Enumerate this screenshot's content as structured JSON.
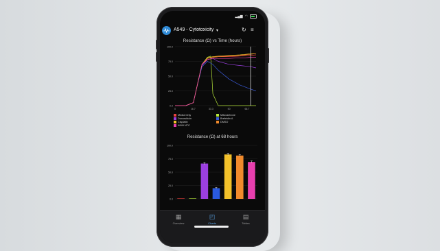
{
  "status_bar": {
    "signal": "▂▄▆",
    "wifi": "◠"
  },
  "header": {
    "title": "A549 - Cytotoxicity",
    "chevron": "▾",
    "refresh_icon": "↻",
    "menu_icon": "≡"
  },
  "line_chart": {
    "title": "Resistance (Ω) vs Time (hours)",
    "y_ticks": [
      "100.0",
      "75.0",
      "50.0",
      "25.0",
      "0.0"
    ],
    "x_ticks": [
      "0",
      "16.7",
      "33.3",
      "50",
      "66.7"
    ],
    "legend": [
      {
        "label": "Media Only",
        "color": "#e8423f"
      },
      {
        "label": "Mitoxantrone",
        "color": "#b6e63a"
      },
      {
        "label": "Doxorubicin",
        "color": "#9b3fe0"
      },
      {
        "label": "Brefeldin A",
        "color": "#3a5ad8"
      },
      {
        "label": "Cisplatin",
        "color": "#f3c12a"
      },
      {
        "label": "DMSO",
        "color": "#f08a2c"
      },
      {
        "label": "A549 NTC",
        "color": "#e83fae"
      }
    ]
  },
  "bar_chart": {
    "title": "Resistance (Ω) at 68 hours",
    "y_ticks": [
      "100.0",
      "75.0",
      "50.0",
      "25.0",
      "0.0"
    ]
  },
  "chart_data": [
    {
      "type": "line",
      "title": "Resistance (Ω) vs Time (hours)",
      "xlim": [
        0,
        75
      ],
      "ylim": [
        0,
        100
      ],
      "cursor_x": 70,
      "series": [
        {
          "name": "Media Only",
          "color": "#e8423f",
          "x": [
            0,
            10,
            17,
            20,
            25,
            30,
            35,
            40,
            50,
            60,
            65,
            70,
            75
          ],
          "y": [
            0,
            0,
            5,
            30,
            70,
            80,
            82,
            83,
            83,
            84,
            85,
            85,
            86
          ]
        },
        {
          "name": "Mitoxantrone",
          "color": "#b6e63a",
          "x": [
            0,
            10,
            17,
            20,
            25,
            30,
            33,
            35,
            40,
            50,
            60,
            70,
            75
          ],
          "y": [
            0,
            0,
            5,
            30,
            70,
            82,
            84,
            20,
            0,
            0,
            0,
            0,
            0
          ]
        },
        {
          "name": "Doxorubicin",
          "color": "#9b3fe0",
          "x": [
            0,
            10,
            17,
            20,
            25,
            30,
            35,
            40,
            50,
            60,
            70,
            75
          ],
          "y": [
            0,
            0,
            5,
            30,
            68,
            78,
            80,
            75,
            70,
            68,
            66,
            64
          ]
        },
        {
          "name": "Brefeldin A",
          "color": "#3a5ad8",
          "x": [
            0,
            10,
            17,
            20,
            25,
            30,
            35,
            40,
            50,
            60,
            70,
            75
          ],
          "y": [
            0,
            0,
            5,
            30,
            66,
            75,
            70,
            60,
            45,
            35,
            28,
            25
          ]
        },
        {
          "name": "Cisplatin",
          "color": "#f3c12a",
          "x": [
            0,
            10,
            17,
            20,
            25,
            30,
            35,
            40,
            50,
            60,
            65,
            70,
            75
          ],
          "y": [
            0,
            0,
            5,
            30,
            70,
            81,
            83,
            84,
            85,
            86,
            87,
            88,
            88
          ]
        },
        {
          "name": "DMSO",
          "color": "#f08a2c",
          "x": [
            0,
            10,
            17,
            20,
            25,
            30,
            35,
            40,
            50,
            60,
            65,
            70,
            75
          ],
          "y": [
            0,
            0,
            5,
            30,
            70,
            80,
            82,
            83,
            84,
            85,
            86,
            87,
            88
          ]
        },
        {
          "name": "A549 NTC",
          "color": "#e83fae",
          "x": [
            0,
            10,
            17,
            20,
            25,
            30,
            35,
            40,
            50,
            60,
            65,
            70,
            75
          ],
          "y": [
            0,
            0,
            5,
            30,
            70,
            78,
            80,
            80,
            80,
            81,
            81,
            82,
            82
          ]
        }
      ]
    },
    {
      "type": "bar",
      "title": "Resistance (Ω) at 68 hours",
      "ylim": [
        0,
        100
      ],
      "categories": [
        "Media Only",
        "Mitoxantrone",
        "Doxorubicin",
        "Brefeldin A",
        "Cisplatin",
        "DMSO",
        "A549 NTC"
      ],
      "values": [
        0.8,
        0.8,
        66,
        20,
        83,
        81,
        69
      ],
      "errors": [
        0,
        0,
        2,
        1.5,
        2.5,
        2,
        2
      ],
      "colors": [
        "#e8423f",
        "#b6e63a",
        "#9b3fe0",
        "#2a5ae0",
        "#f3c12a",
        "#f08a2c",
        "#e83fae"
      ]
    }
  ],
  "tabbar": {
    "tabs": [
      {
        "label": "Overview",
        "icon": "▦"
      },
      {
        "label": "Charts",
        "icon": "◰"
      },
      {
        "label": "Tables",
        "icon": "▤"
      }
    ]
  }
}
